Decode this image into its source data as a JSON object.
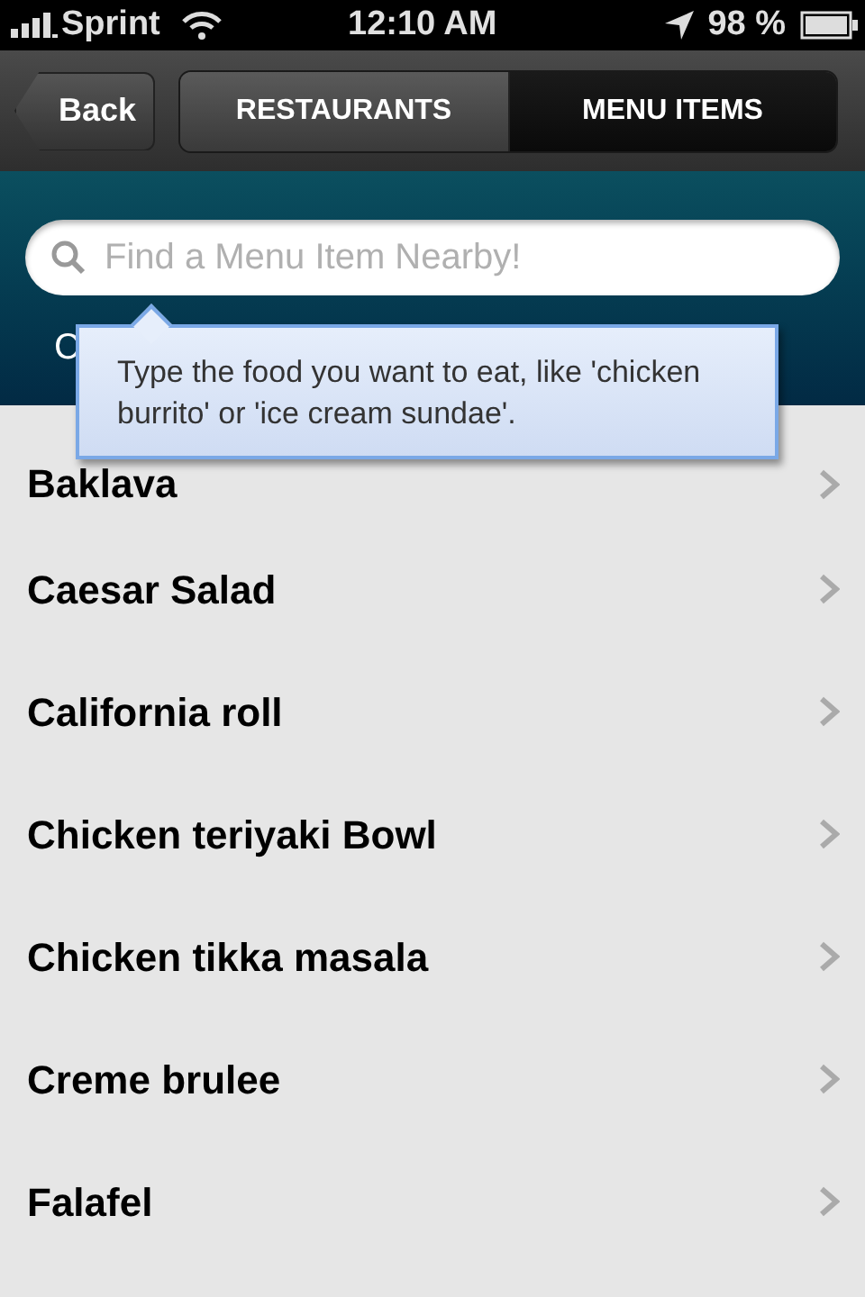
{
  "status_bar": {
    "carrier": "Sprint",
    "time": "12:10 AM",
    "battery": "98 %"
  },
  "nav": {
    "back": "Back",
    "tabs": [
      {
        "label": "RESTAURANTS",
        "selected": false
      },
      {
        "label": "MENU ITEMS",
        "selected": true
      }
    ]
  },
  "search": {
    "placeholder": "Find a Menu Item Nearby!",
    "covered_text": "C"
  },
  "tooltip": "Type the food you want to eat, like 'chicken burrito' or 'ice cream sundae'.",
  "items": [
    "Baklava",
    "Caesar Salad",
    "California roll",
    "Chicken teriyaki Bowl",
    "Chicken tikka masala",
    "Creme brulee",
    "Falafel"
  ]
}
